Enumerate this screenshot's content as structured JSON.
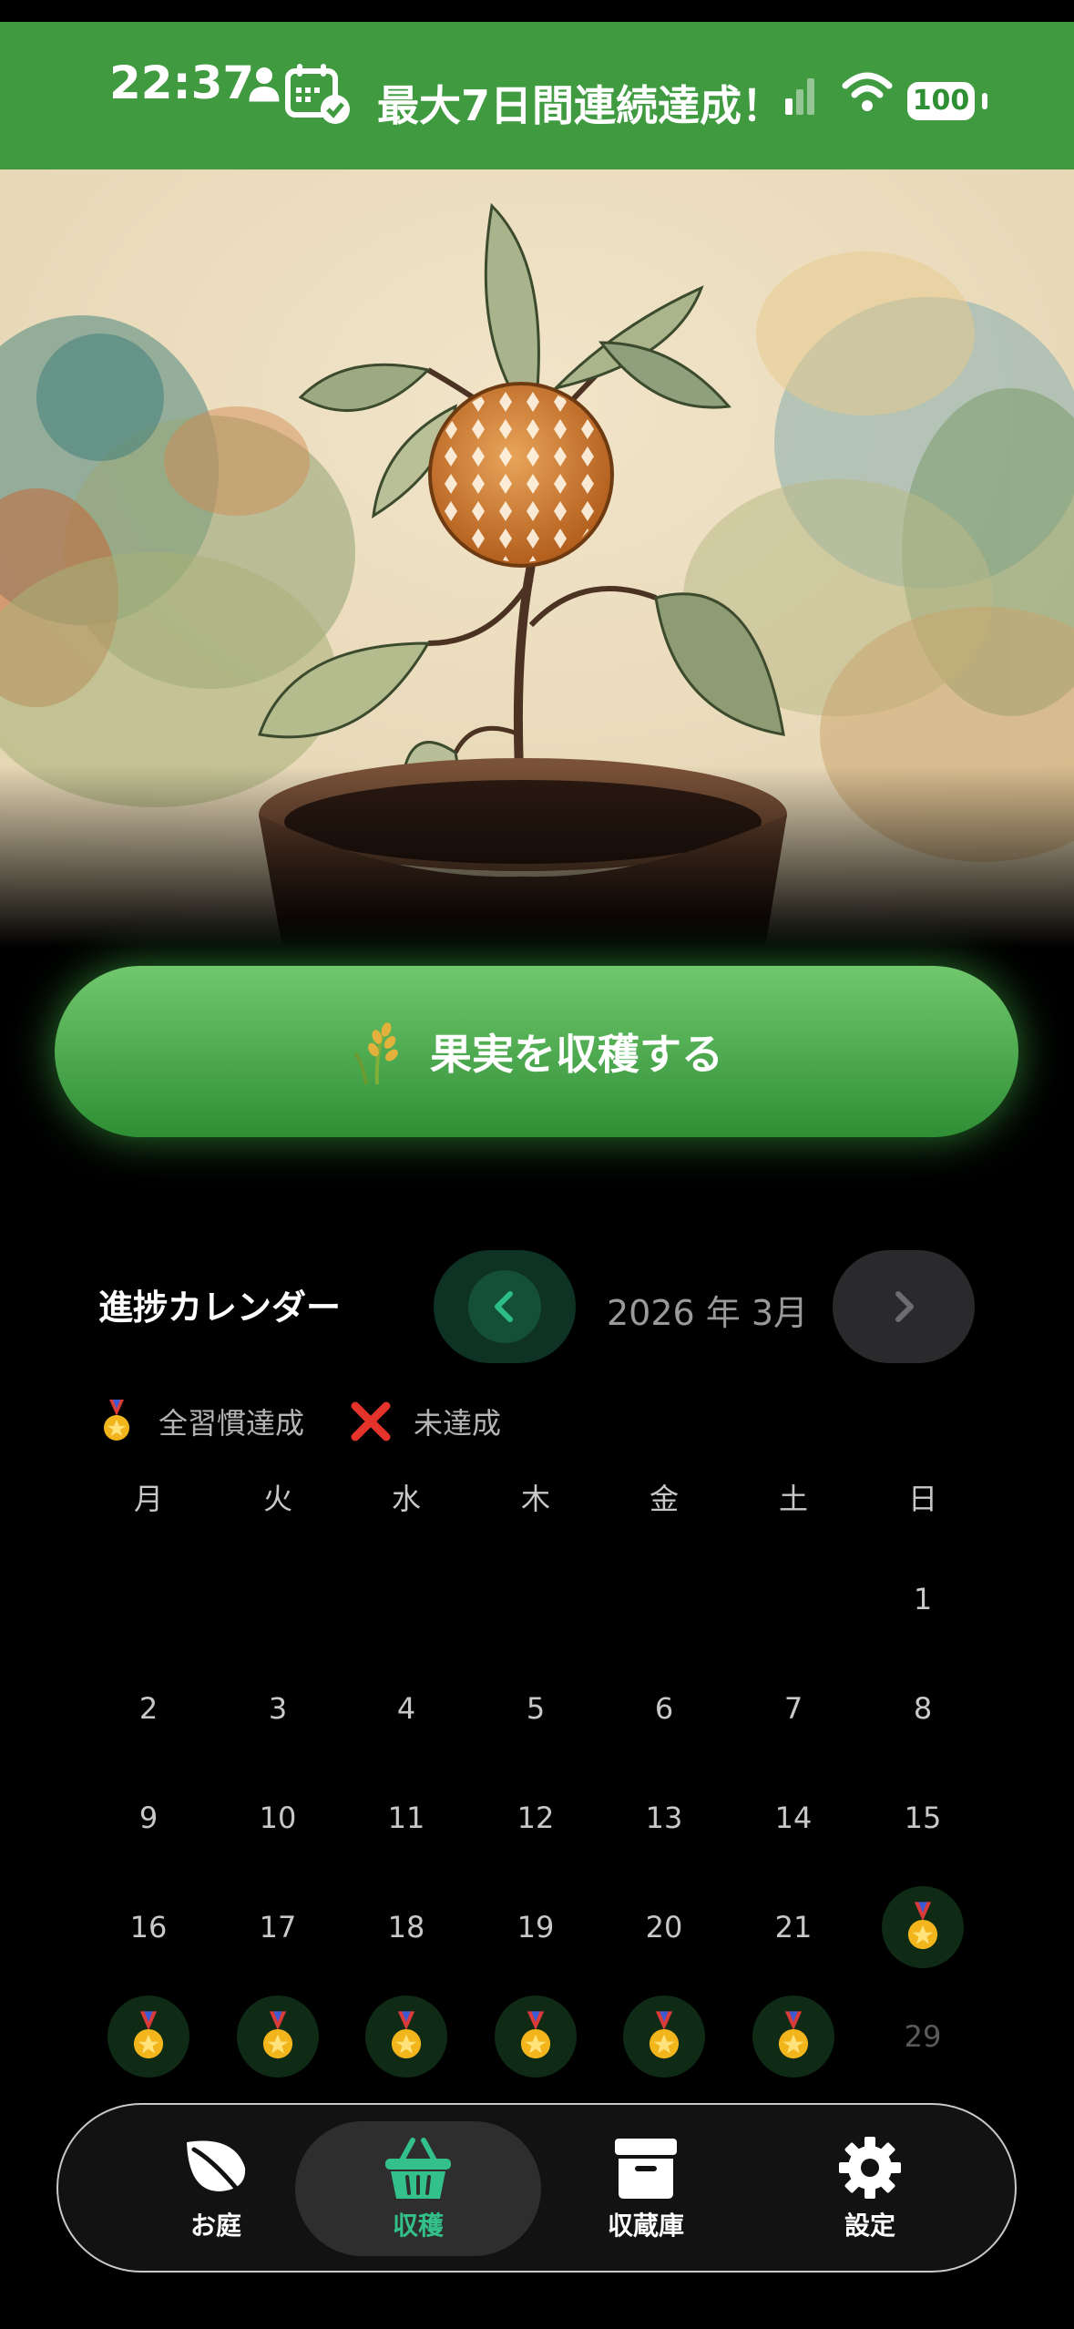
{
  "status_bar": {
    "time": "22:37",
    "banner": "最大7日間連続達成！",
    "battery": "100"
  },
  "harvest_button": {
    "label": "果実を収穫する"
  },
  "calendar": {
    "title": "進捗カレンダー",
    "month": "2026 年 3月",
    "legend": {
      "achieved": "全習慣達成",
      "missed": "未達成"
    },
    "weekdays": [
      "月",
      "火",
      "水",
      "木",
      "金",
      "土",
      "日"
    ],
    "rows": [
      [
        "",
        "",
        "",
        "",
        "",
        "",
        "1"
      ],
      [
        "2",
        "3",
        "4",
        "5",
        "6",
        "7",
        "8"
      ],
      [
        "9",
        "10",
        "11",
        "12",
        "13",
        "14",
        "15"
      ],
      [
        "16",
        "17",
        "18",
        "19",
        "20",
        "21",
        "medal"
      ],
      [
        "medal",
        "medal",
        "medal",
        "medal",
        "medal",
        "medal",
        "29"
      ]
    ]
  },
  "tabs": [
    {
      "label": "お庭",
      "icon": "leaf-icon"
    },
    {
      "label": "収穫",
      "icon": "basket-icon"
    },
    {
      "label": "収蔵庫",
      "icon": "archive-box-icon"
    },
    {
      "label": "設定",
      "icon": "gear-icon"
    }
  ],
  "colors": {
    "status_bar_green": "#3f9a40",
    "harvest_green": "#2e8f35",
    "active_tab_teal": "#33c08a"
  }
}
